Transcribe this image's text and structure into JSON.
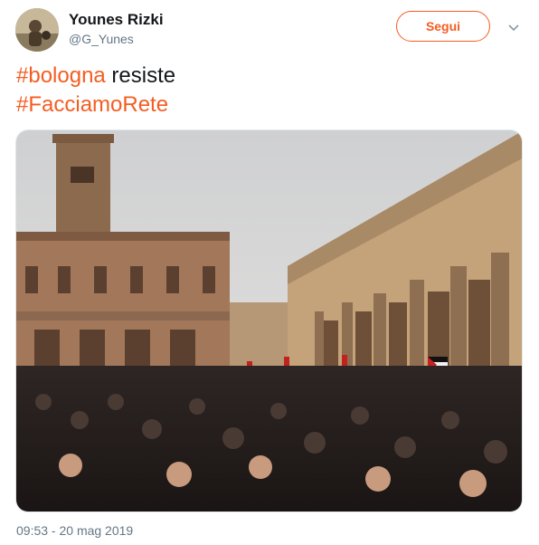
{
  "author": {
    "name": "Younes Rizki",
    "handle": "@G_Yunes",
    "avatar_icon": "profile-photo"
  },
  "actions": {
    "follow_label": "Segui",
    "more_icon": "chevron-down-icon"
  },
  "tweet": {
    "line1_hashtag": "#bologna",
    "line1_text": " resiste",
    "line2_hashtag": "#FacciamoRete"
  },
  "media": {
    "type": "photo"
  },
  "timestamp": "09:53 - 20 mag 2019",
  "colors": {
    "accent": "#f45d22",
    "secondary_text": "#657786",
    "primary_text": "#14171a"
  }
}
